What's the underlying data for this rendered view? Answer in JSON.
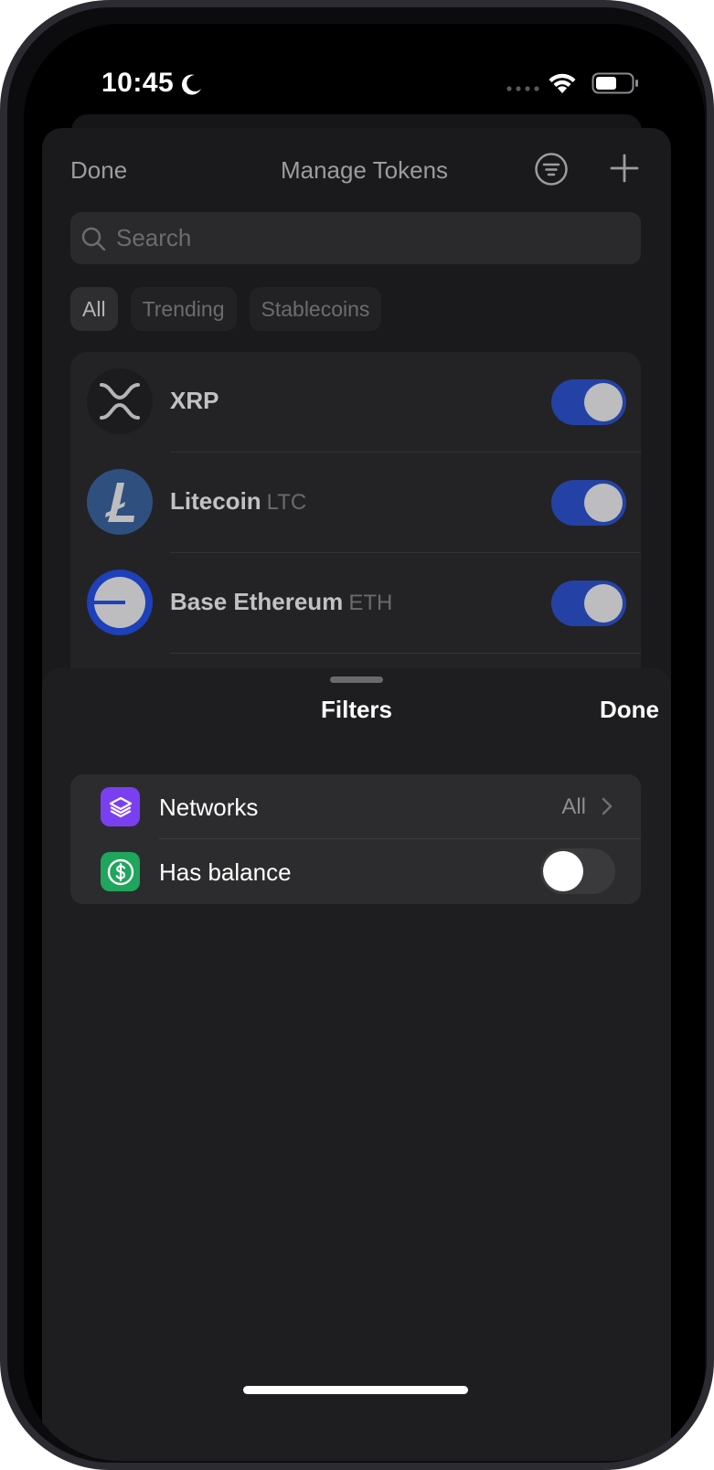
{
  "status_bar": {
    "time": "10:45",
    "moon_icon": "moon-icon",
    "wifi_icon": "wifi-icon",
    "battery_icon": "battery-icon"
  },
  "manage_tokens": {
    "done_label": "Done",
    "title": "Manage Tokens",
    "filter_icon": "filter-icon",
    "add_icon": "plus-icon",
    "search": {
      "placeholder": "Search"
    },
    "chips": [
      {
        "label": "All",
        "active": true
      },
      {
        "label": "Trending",
        "active": false
      },
      {
        "label": "Stablecoins",
        "active": false
      }
    ],
    "tokens": [
      {
        "name": "XRP",
        "symbol": "",
        "enabled": true,
        "logo": "xrp-logo-icon"
      },
      {
        "name": "Litecoin",
        "symbol": "LTC",
        "enabled": true,
        "logo": "litecoin-logo-icon"
      },
      {
        "name": "Base Ethereum",
        "symbol": "ETH",
        "enabled": true,
        "logo": "base-logo-icon"
      }
    ]
  },
  "filters_sheet": {
    "title": "Filters",
    "done_label": "Done",
    "rows": [
      {
        "label": "Networks",
        "value": "All",
        "icon": "layers-icon",
        "icon_color": "#7b3ff2"
      },
      {
        "label": "Has balance",
        "toggle": false,
        "icon": "dollar-icon",
        "icon_color": "#1fa55c"
      }
    ]
  },
  "colors": {
    "toggle_on": "#2442a5",
    "sheet_bg": "#1e1e20",
    "accent_text": "#ffffff"
  }
}
